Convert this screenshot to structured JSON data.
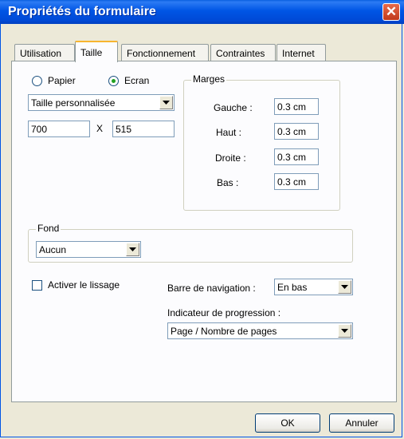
{
  "window": {
    "title": "Propriétés du formulaire",
    "close_glyph": "✕"
  },
  "tabs": [
    {
      "label": "Utilisation",
      "active": false
    },
    {
      "label": "Taille",
      "active": true
    },
    {
      "label": "Fonctionnement",
      "active": false
    },
    {
      "label": "Contraintes",
      "active": false
    },
    {
      "label": "Internet",
      "active": false
    }
  ],
  "size": {
    "radio_paper": {
      "label": "Papier",
      "selected": false
    },
    "radio_screen": {
      "label": "Ecran",
      "selected": true
    },
    "preset": "Taille personnalisée",
    "width": "700",
    "separator": "X",
    "height": "515"
  },
  "margins": {
    "title": "Marges",
    "left_label": "Gauche :",
    "left_value": "0.3 cm",
    "top_label": "Haut :",
    "top_value": "0.3 cm",
    "right_label": "Droite :",
    "right_value": "0.3 cm",
    "bottom_label": "Bas :",
    "bottom_value": "0.3 cm"
  },
  "background": {
    "title": "Fond",
    "value": "Aucun"
  },
  "smoothing": {
    "label": "Activer le lissage",
    "checked": false
  },
  "navigation": {
    "label": "Barre de navigation :",
    "value": "En bas"
  },
  "progress": {
    "label": "Indicateur de progression :",
    "value": "Page / Nombre de pages"
  },
  "buttons": {
    "ok": "OK",
    "cancel": "Annuler"
  }
}
